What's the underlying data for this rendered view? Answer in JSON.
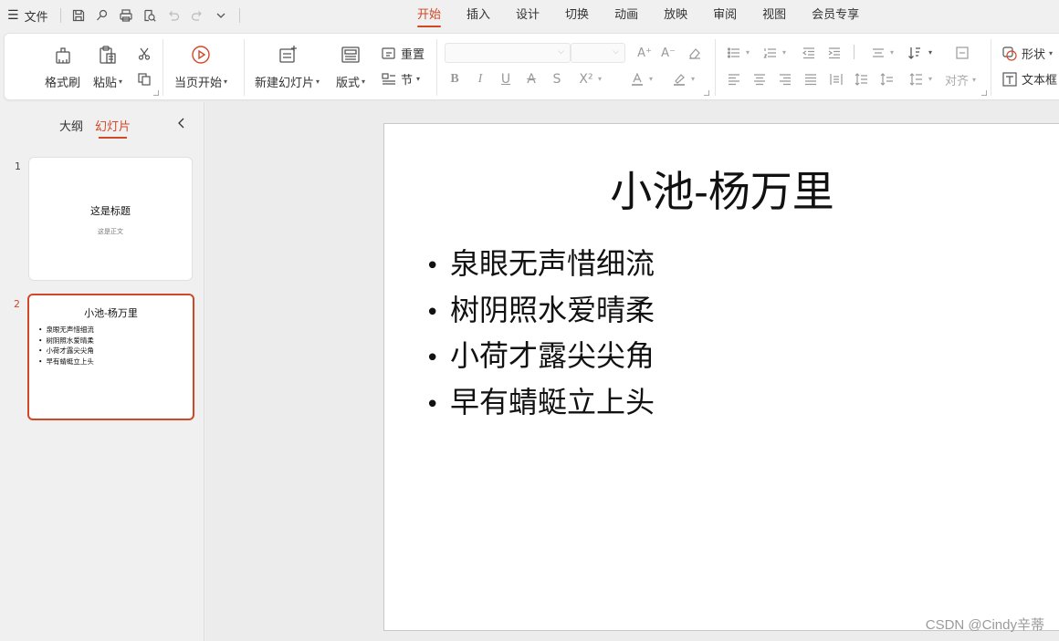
{
  "menubar": {
    "file_label": "文件",
    "quick_icons": [
      "save-icon",
      "magic-icon",
      "print-icon",
      "print-preview-icon",
      "undo-icon",
      "redo-icon",
      "more-icon"
    ],
    "tabs": [
      {
        "label": "开始",
        "active": true
      },
      {
        "label": "插入"
      },
      {
        "label": "设计"
      },
      {
        "label": "切换"
      },
      {
        "label": "动画"
      },
      {
        "label": "放映"
      },
      {
        "label": "审阅"
      },
      {
        "label": "视图"
      },
      {
        "label": "会员专享"
      }
    ]
  },
  "ribbon": {
    "format_painter": "格式刷",
    "paste": "粘贴",
    "play_from_current": "当页开始",
    "new_slide": "新建幻灯片",
    "layout": "版式",
    "reset": "重置",
    "section": "节",
    "align_label": "对齐",
    "shape": "形状",
    "textbox": "文本框"
  },
  "panel": {
    "outline_tab": "大纲",
    "slides_tab": "幻灯片"
  },
  "slides": [
    {
      "number": "1",
      "title": "这是标题",
      "subtitle": "这是正文"
    },
    {
      "number": "2",
      "title": "小池-杨万里",
      "bullets": [
        "泉眼无声惜细流",
        "树阴照水爱晴柔",
        "小荷才露尖尖角",
        "早有蜻蜓立上头"
      ]
    }
  ],
  "current_slide": {
    "title": "小池-杨万里",
    "bullets": [
      "泉眼无声惜细流",
      "树阴照水爱晴柔",
      "小荷才露尖尖角",
      "早有蜻蜓立上头"
    ]
  },
  "watermark": "CSDN @Cindy辛蒂",
  "colors": {
    "accent": "#d24726"
  }
}
